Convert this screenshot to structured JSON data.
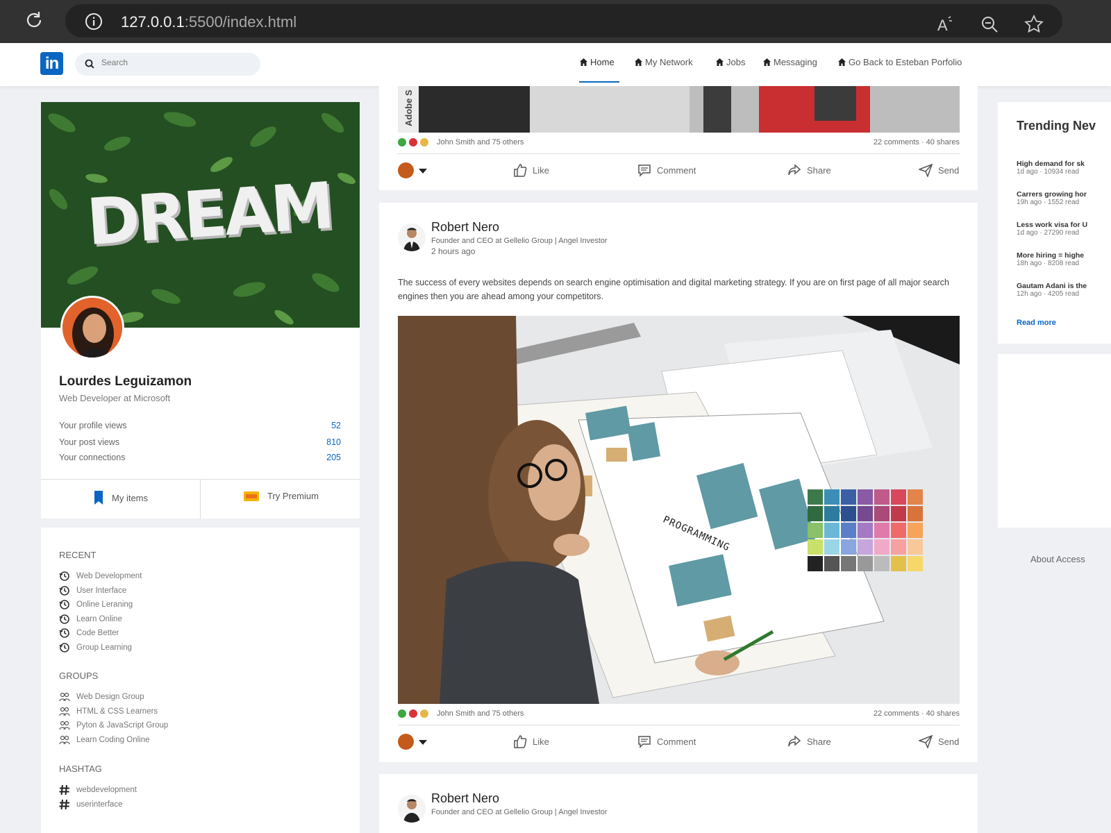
{
  "browser": {
    "url_host": "127.0.0.1",
    "url_rest": ":5500/index.html"
  },
  "nav": {
    "logo": "in",
    "search_placeholder": "Search",
    "items": [
      "Home",
      "My Network",
      "Jobs",
      "Messaging",
      "Go Back to Esteban Porfolio"
    ],
    "active": "Home",
    "accent_color": "#0a66c2"
  },
  "profile": {
    "cover_text": "DREAM",
    "name": "Lourdes Leguizamon",
    "title": "Web Developer at Microsoft",
    "stats": [
      {
        "label": "Your profile views",
        "value": "52"
      },
      {
        "label": "Your post views",
        "value": "810"
      },
      {
        "label": "Your connections",
        "value": "205"
      }
    ],
    "my_items": "My items",
    "try_premium": "Try Premium"
  },
  "sidebar": {
    "recent_heading": "RECENT",
    "recent": [
      "Web Development",
      "User Interface",
      "Online Leraning",
      "Learn Online",
      "Code Better",
      "Group Learning"
    ],
    "groups_heading": "GROUPS",
    "groups": [
      "Web Design Group",
      "HTML & CSS Learners",
      "Pyton & JavaScript Group",
      "Learn Coding Online"
    ],
    "hashtag_heading": "HASHTAG",
    "hashtags": [
      "webdevelopment",
      "userinterface"
    ]
  },
  "posts": [
    {
      "image_caption": "Adobe S",
      "reactions": "John Smith and 75 others",
      "counts": "22 comments · 40 shares"
    },
    {
      "author": "Robert Nero",
      "subtitle": "Founder and CEO at Gellelio Group | Angel Investor",
      "time": "2 hours ago",
      "text": "The success of every websites depends on search engine optimisation and digital marketing strategy. If you are on first page of all major search engines then you are ahead among your competitors.",
      "image_word": "PROGRAMMING",
      "reactions": "John Smith and 75 others",
      "counts": "22 comments · 40 shares"
    },
    {
      "author": "Robert Nero",
      "subtitle": "Founder and CEO at Gellelio Group | Angel Investor"
    }
  ],
  "actions": {
    "like": "Like",
    "comment": "Comment",
    "share": "Share",
    "send": "Send"
  },
  "trending": {
    "title": "Trending Nev",
    "items": [
      {
        "head": "High demand for sk",
        "meta": "1d ago · 10934 read"
      },
      {
        "head": "Carrers growing hor",
        "meta": "19h ago · 1552 read"
      },
      {
        "head": "Less work visa for U",
        "meta": "1d ago · 27290 read"
      },
      {
        "head": "More hiring = highe",
        "meta": "18h ago · 8208 read"
      },
      {
        "head": "Gautam Adani is the",
        "meta": "12h ago · 4205 read"
      }
    ],
    "read_more": "Read more"
  },
  "footer": {
    "links": "About  Access"
  }
}
